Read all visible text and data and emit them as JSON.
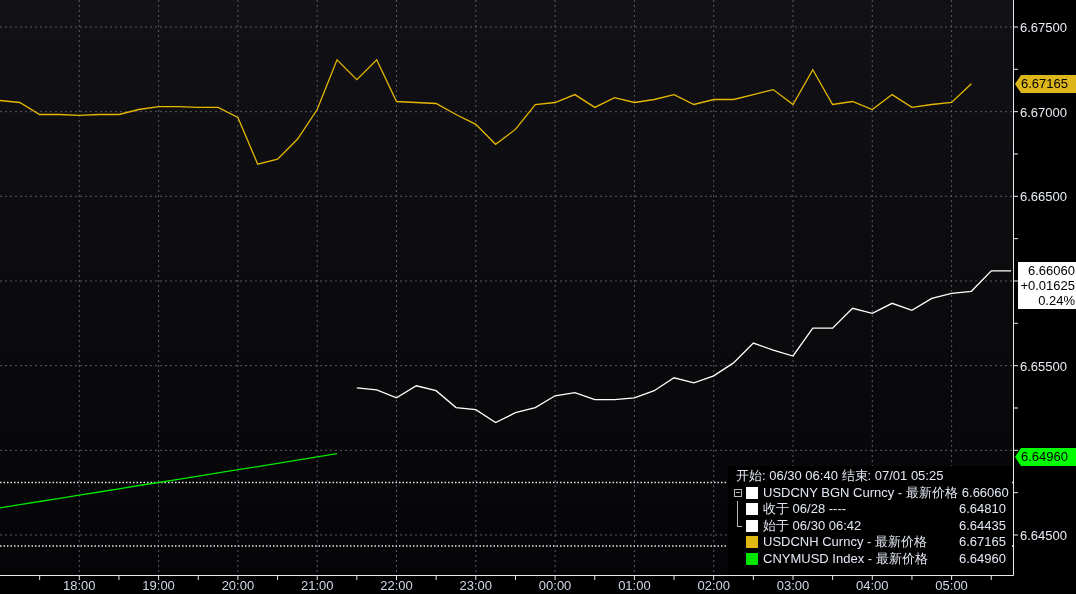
{
  "chart": {
    "chart_data": {
      "type": "line",
      "categories": [
        null,
        null,
        null,
        null,
        "18:00",
        null,
        null,
        null,
        "19:00",
        null,
        null,
        null,
        "20:00",
        null,
        null,
        null,
        "21:00",
        null,
        null,
        null,
        "22:00",
        null,
        null,
        null,
        "23:00",
        null,
        null,
        null,
        "00:00",
        null,
        null,
        null,
        "01:00",
        null,
        null,
        null,
        "02:00",
        null,
        null,
        null,
        "03:00",
        null,
        null,
        null,
        "04:00",
        null,
        null,
        null,
        "05:00",
        null,
        null,
        null
      ],
      "series": [
        {
          "color": "#e6b800",
          "values": [
            6.67066,
            6.67054,
            6.66983,
            6.66983,
            6.66978,
            6.66983,
            6.66983,
            6.67013,
            6.6703,
            6.6703,
            6.67025,
            6.67025,
            6.66966,
            6.6669,
            6.66719,
            6.66837,
            6.67013,
            6.67306,
            6.67189,
            6.67306,
            6.6706,
            6.67054,
            6.67048,
            6.66983,
            6.66925,
            6.66807,
            6.66895,
            6.67042,
            6.67054,
            6.67101,
            6.67025,
            6.67083,
            6.67054,
            6.67072,
            6.67101,
            6.67042,
            6.67072,
            6.67072,
            6.67101,
            6.6713,
            6.67042,
            6.67248,
            6.67042,
            6.6706,
            6.67013,
            6.67101,
            6.67025,
            6.67042,
            6.67054,
            6.67165,
            null,
            null
          ]
        },
        {
          "color": "#ffffff",
          "values": [
            null,
            null,
            null,
            null,
            null,
            null,
            null,
            null,
            null,
            null,
            null,
            null,
            null,
            null,
            null,
            null,
            null,
            null,
            6.65369,
            6.65357,
            6.6531,
            6.65381,
            6.65352,
            6.65252,
            6.6524,
            6.65164,
            6.65222,
            6.65252,
            6.65322,
            6.6534,
            6.65299,
            6.65299,
            6.6531,
            6.65352,
            6.65428,
            6.65399,
            6.6544,
            6.65516,
            6.65633,
            6.65592,
            6.65557,
            6.65721,
            6.65721,
            6.65839,
            6.65809,
            6.65868,
            6.65827,
            6.65897,
            6.65927,
            6.65939,
            6.6606,
            6.6606
          ]
        },
        {
          "color": "#00e600",
          "values": [
            6.6466,
            6.64679,
            6.64698,
            6.64716,
            6.64735,
            6.64754,
            6.64773,
            6.64792,
            6.6481,
            6.64829,
            6.64848,
            6.64867,
            6.64886,
            6.64904,
            6.64923,
            6.64942,
            6.64961,
            6.6498,
            null,
            null,
            null,
            null,
            null,
            null,
            null,
            null,
            null,
            null,
            null,
            null,
            null,
            null,
            null,
            null,
            null,
            null,
            null,
            null,
            null,
            null,
            null,
            null,
            null,
            null,
            null,
            null,
            null,
            null,
            null,
            null,
            null,
            null
          ]
        }
      ],
      "yticks": [
        {
          "value": 6.675,
          "label": "6.67500"
        },
        {
          "value": 6.67,
          "label": "6.67000"
        },
        {
          "value": 6.665,
          "label": "6.66500"
        },
        {
          "value": 6.655,
          "label": "6.65500"
        },
        {
          "value": 6.645,
          "label": "6.64500"
        }
      ],
      "ylim": [
        6.642637,
        6.676594
      ],
      "grid": true,
      "ref_lines": [
        {
          "axis": "y",
          "value": 6.6481,
          "color": "#e8e8e8"
        },
        {
          "axis": "y",
          "value": 6.64435,
          "color": "#e8e8e8"
        }
      ]
    }
  },
  "price_tags": [
    {
      "kind": "pointer",
      "text": "6.67165",
      "color": "#ddb61c"
    },
    {
      "kind": "box",
      "lines": [
        "6.66060",
        "+0.01625",
        "0.24%"
      ]
    },
    {
      "kind": "pointer",
      "text": "6.64960",
      "color": "#00ff00"
    }
  ],
  "legend": {
    "header": "开始: 06/30 06:40 结束: 07/01 05:25",
    "items": [
      {
        "color": "#ffffff",
        "label": "USDCNY BGN Curncy - 最新价格",
        "value": "6.66060",
        "expanded": true,
        "children": [
          {
            "color": "#ffffff",
            "label": "收于 06/28 ----",
            "value": "6.64810"
          },
          {
            "color": "#ffffff",
            "label": "始于 06/30 06:42",
            "value": "6.64435"
          }
        ]
      },
      {
        "color": "#e0b814",
        "label": "USDCNH Curncy - 最新价格",
        "value": "6.67165"
      },
      {
        "color": "#00e600",
        "label": "CNYMUSD Index - 最新价格",
        "value": "6.64960"
      }
    ]
  }
}
